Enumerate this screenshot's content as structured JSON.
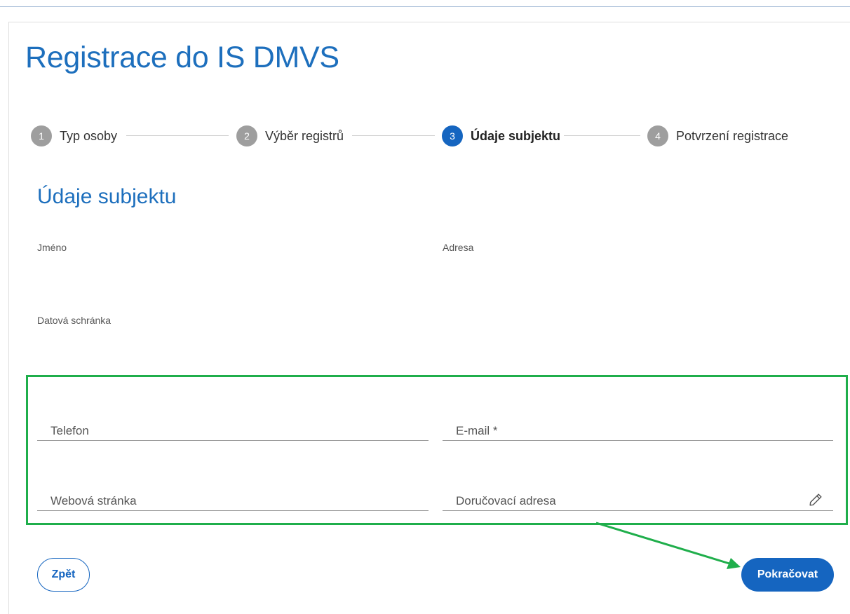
{
  "page": {
    "title": "Registrace do IS DMVS"
  },
  "stepper": {
    "steps": [
      {
        "num": "1",
        "label": "Typ osoby"
      },
      {
        "num": "2",
        "label": "Výběr registrů"
      },
      {
        "num": "3",
        "label": "Údaje subjektu"
      },
      {
        "num": "4",
        "label": "Potvrzení registrace"
      }
    ],
    "active_index": 2
  },
  "section": {
    "title": "Údaje subjektu",
    "labels": {
      "name": "Jméno",
      "address": "Adresa",
      "data_box": "Datová schránka"
    }
  },
  "form": {
    "phone_label": "Telefon",
    "email_label": "E-mail *",
    "website_label": "Webová stránka",
    "delivery_address_label": "Doručovací adresa"
  },
  "actions": {
    "back_label": "Zpět",
    "continue_label": "Pokračovat"
  },
  "colors": {
    "primary": "#1565c0",
    "title": "#1d6fbd",
    "highlight": "#1fae4b",
    "inactive_step": "#9e9e9e"
  },
  "icons": {
    "delivery_address_edit": "pencil-icon"
  }
}
